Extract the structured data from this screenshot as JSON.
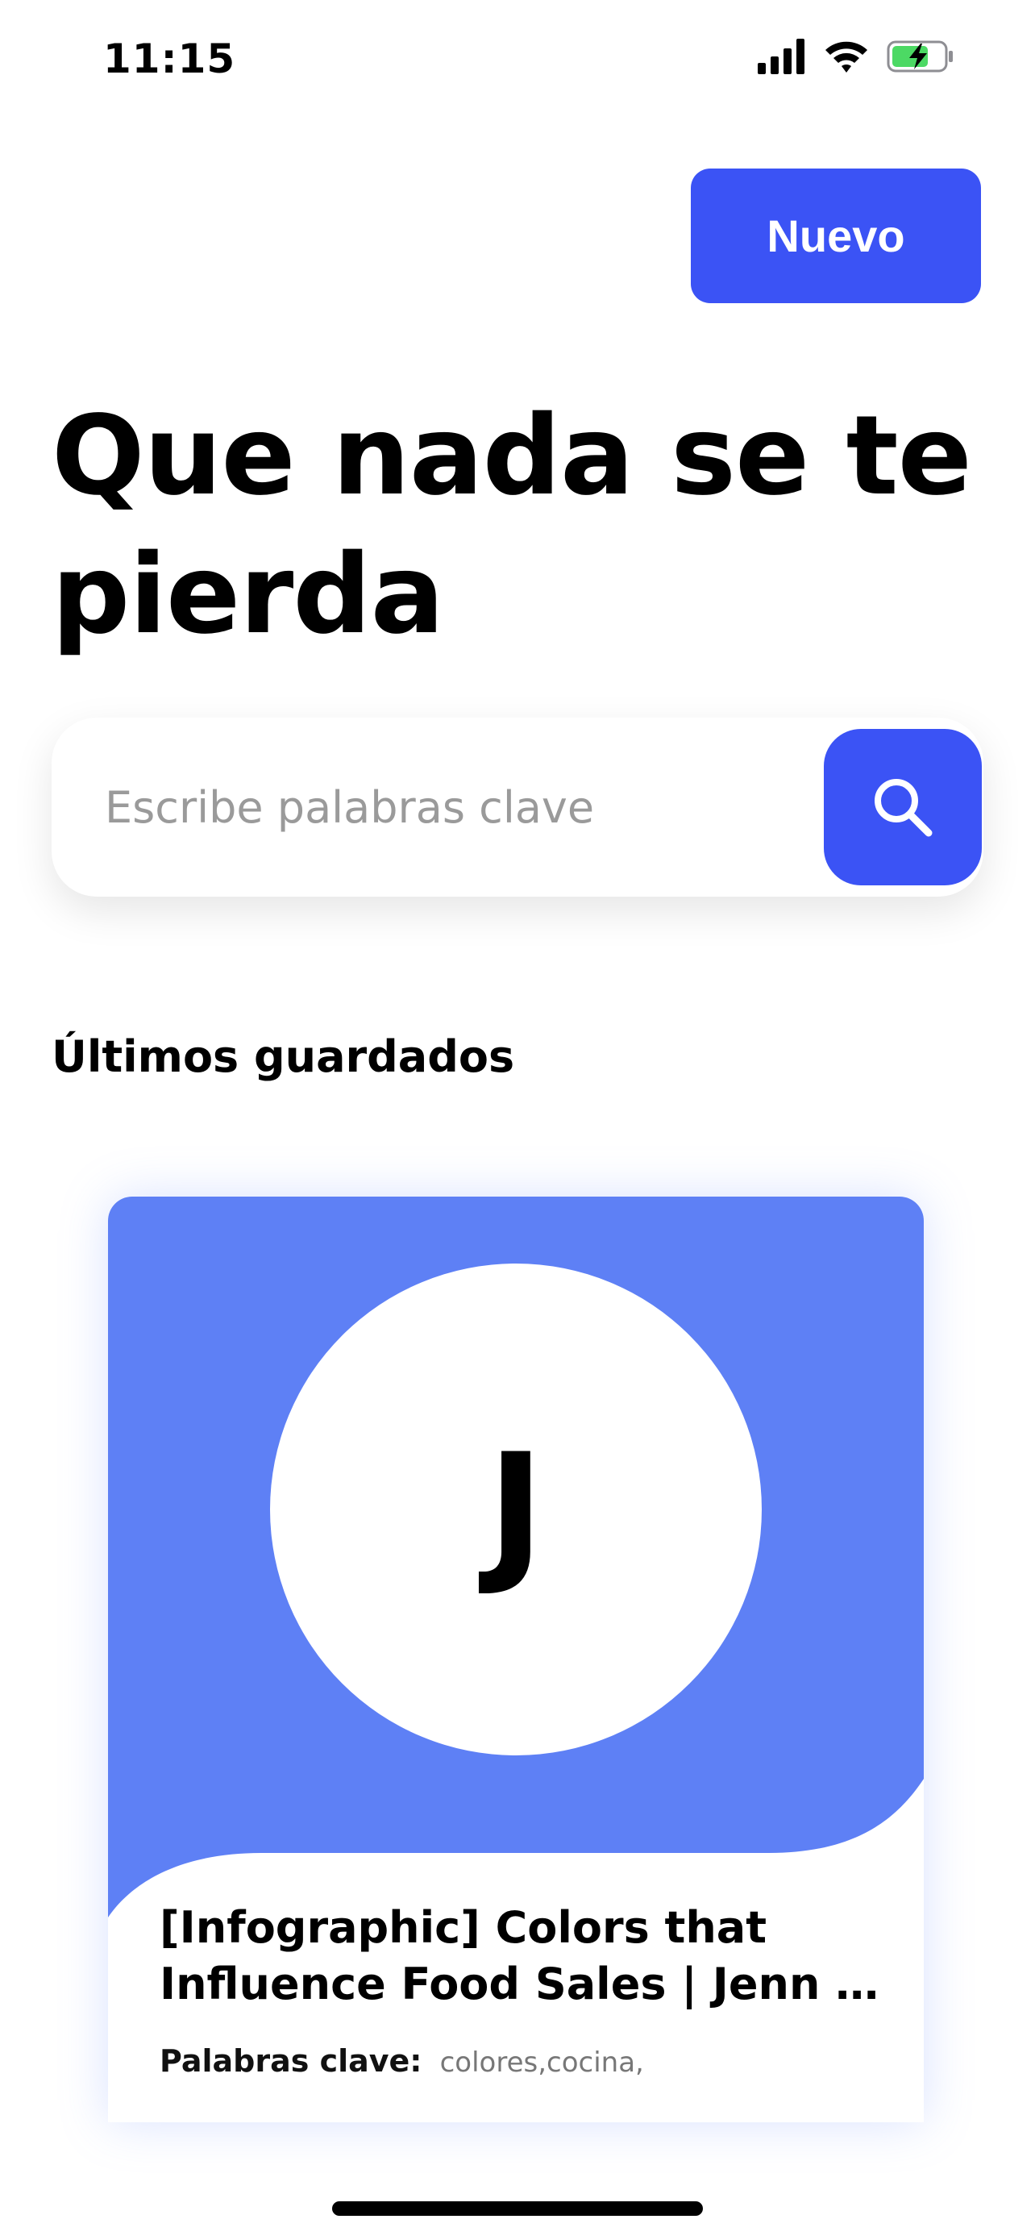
{
  "status_bar": {
    "time": "11:15",
    "icons": [
      "cellular-signal-icon",
      "wifi-icon",
      "battery-charging-icon"
    ],
    "battery_color": "#4cd964"
  },
  "header": {
    "new_button_label": "Nuevo"
  },
  "headline": {
    "line1": "Que nada se te",
    "line2": "pierda"
  },
  "search": {
    "placeholder": "Escribe palabras clave",
    "value": "",
    "button_icon": "search-icon"
  },
  "recent": {
    "section_title": "Últimos guardados",
    "cards": [
      {
        "initial": "J",
        "title_line1": "[Infographic] Colors that",
        "title_line2": "Influence Food Sales | Jenn …",
        "keywords_label": "Palabras clave:",
        "keywords_value": "colores,cocina,"
      }
    ]
  },
  "colors": {
    "accent": "#3b53f5",
    "card_hero": "#5e80f5",
    "text": "#000000",
    "placeholder": "#9a9a9a"
  }
}
